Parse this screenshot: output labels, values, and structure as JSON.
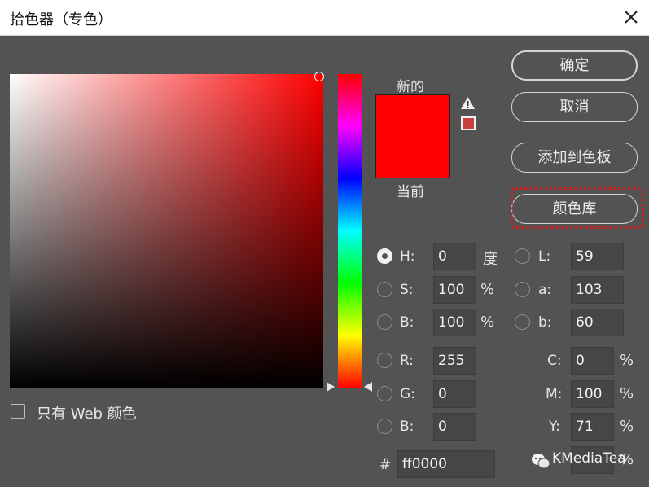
{
  "window": {
    "title": "拾色器（专色）"
  },
  "buttons": {
    "ok": "确定",
    "cancel": "取消",
    "add_to_swatches": "添加到色板",
    "color_libraries": "颜色库"
  },
  "preview": {
    "new_label": "新的",
    "current_label": "当前",
    "new_color": "#ff0000",
    "current_color": "#ff0000"
  },
  "webonly": {
    "label": "只有 Web 颜色",
    "checked": false
  },
  "hsb": {
    "h": {
      "label": "H:",
      "value": "0",
      "unit": "度",
      "selected": true
    },
    "s": {
      "label": "S:",
      "value": "100",
      "unit": "%",
      "selected": false
    },
    "b": {
      "label": "B:",
      "value": "100",
      "unit": "%",
      "selected": false
    }
  },
  "rgb": {
    "r": {
      "label": "R:",
      "value": "255"
    },
    "g": {
      "label": "G:",
      "value": "0"
    },
    "b": {
      "label": "B:",
      "value": "0"
    }
  },
  "lab": {
    "l": {
      "label": "L:",
      "value": "59"
    },
    "a": {
      "label": "a:",
      "value": "103"
    },
    "b": {
      "label": "b:",
      "value": "60"
    }
  },
  "cmyk": {
    "c": {
      "label": "C:",
      "value": "0",
      "unit": "%"
    },
    "m": {
      "label": "M:",
      "value": "100",
      "unit": "%"
    },
    "y": {
      "label": "Y:",
      "value": "71",
      "unit": "%"
    },
    "k": {
      "unit": "%"
    }
  },
  "hex": {
    "label": "#",
    "value": "ff0000"
  },
  "watermark": "KMediaTea",
  "icons": [
    "close-icon",
    "gamut-warning-icon",
    "websafe-swatch-icon",
    "wechat-icon"
  ],
  "colors": {
    "background": "#535353",
    "field": "#464646",
    "highlight": "#d32020"
  }
}
